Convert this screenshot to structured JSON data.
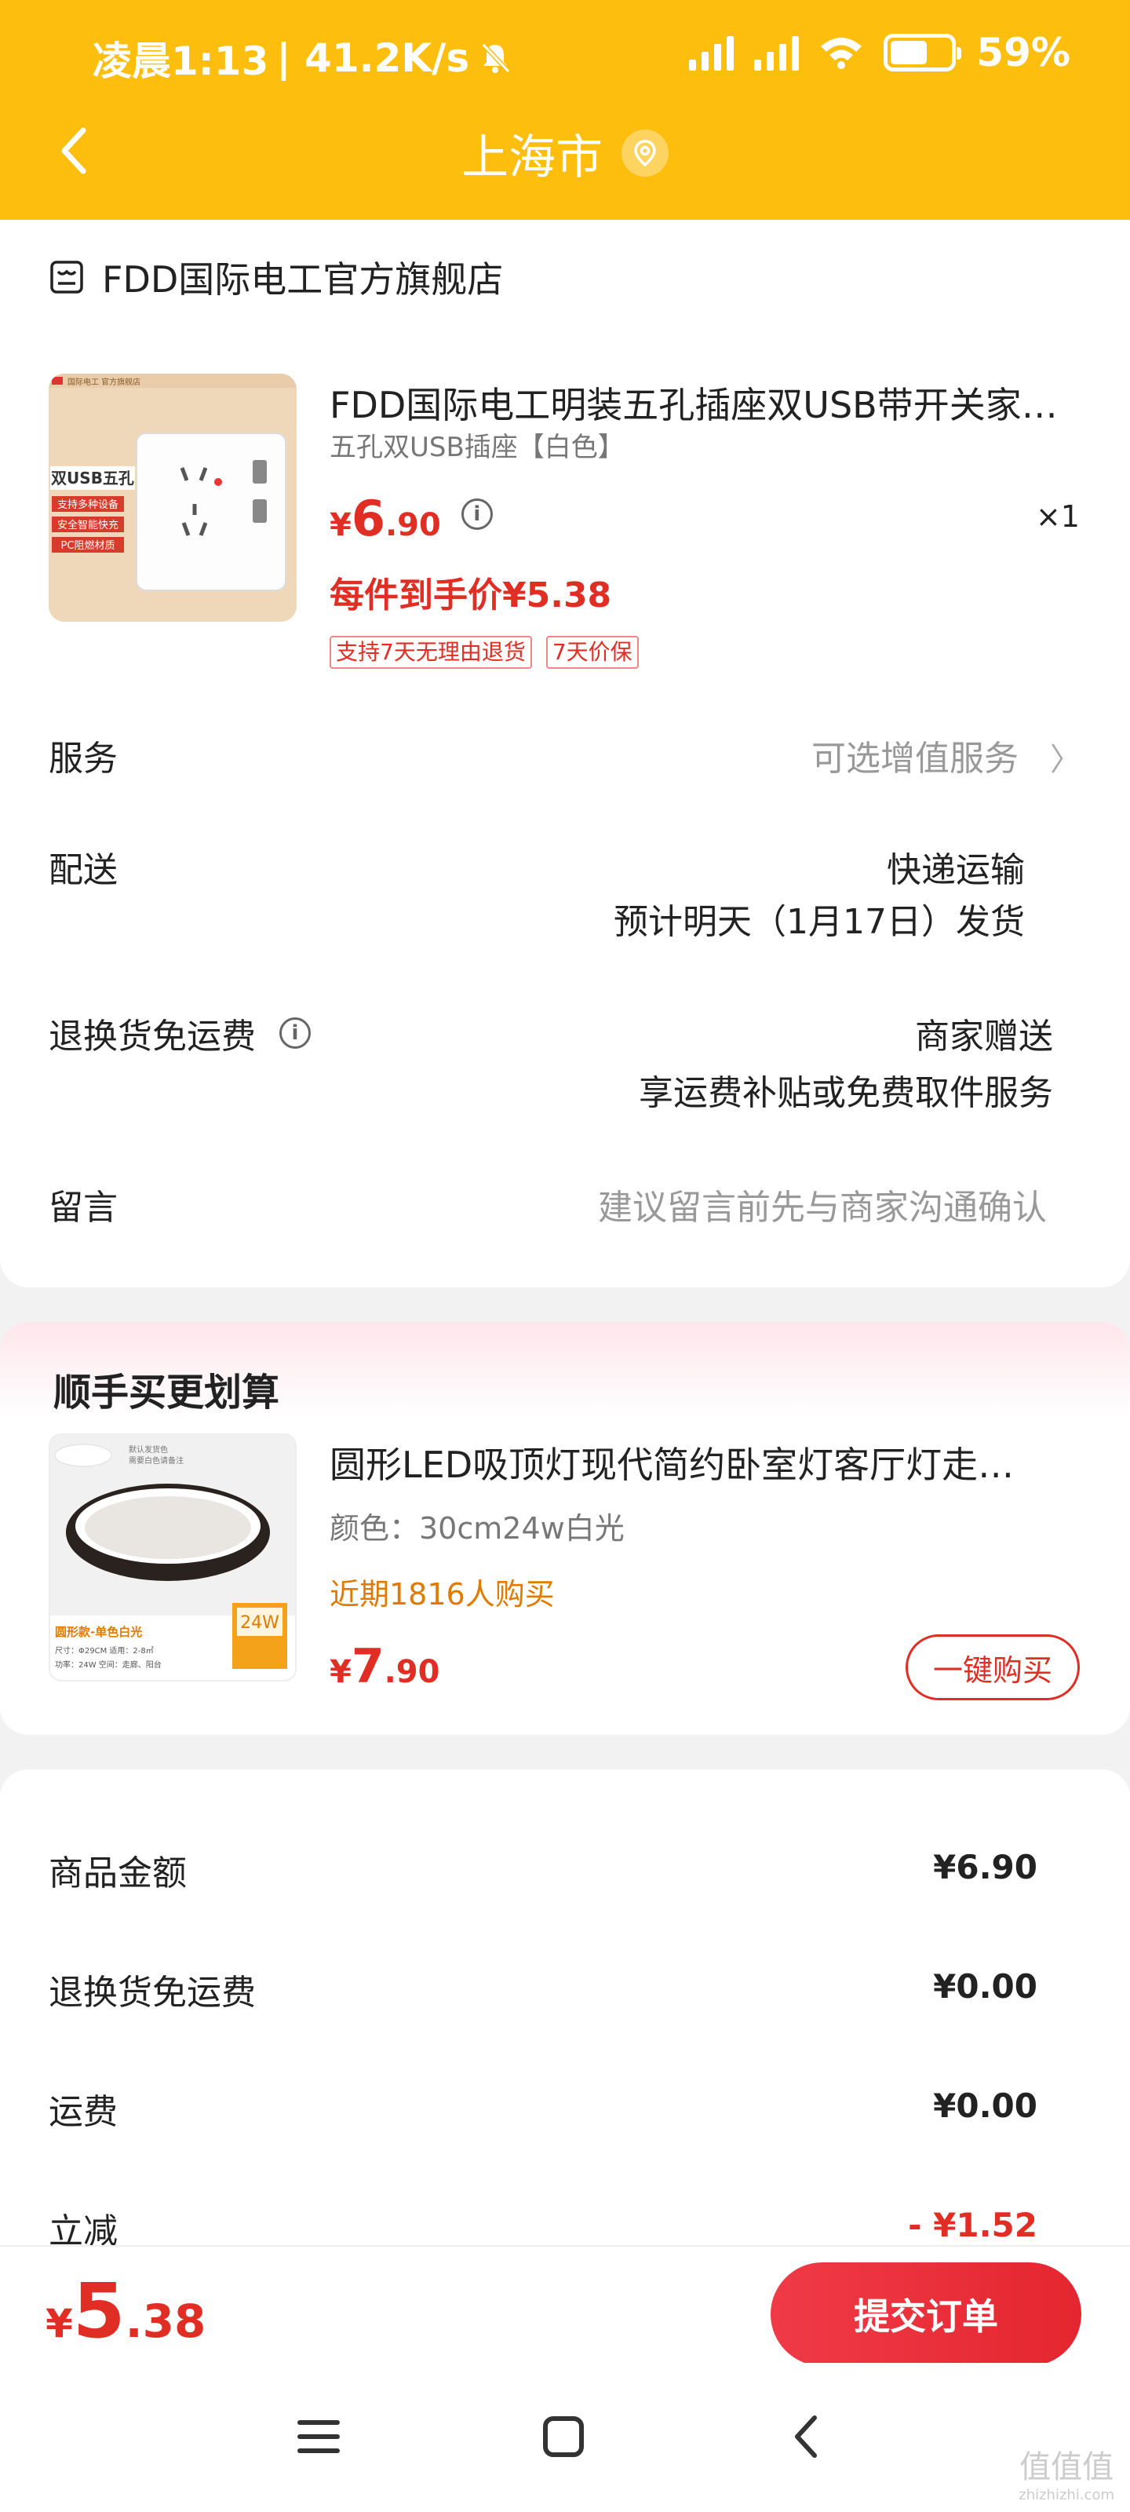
{
  "status_bar": {
    "time": "凌晨1:13",
    "net_speed": "| 41.2K/s",
    "battery": "59%"
  },
  "nav": {
    "title": "上海市"
  },
  "order": {
    "shop_name": "FDD国际电工官方旗舰店",
    "product": {
      "title": "FDD国际电工明装五孔插座双USB带开关家…",
      "spec": "五孔双USB插座【白色】",
      "price_yen": "¥",
      "price_int": "6",
      "price_dec": ".90",
      "quantity": "×1",
      "final_price": "每件到手价¥5.38",
      "tags": [
        "支持7天无理由退货",
        "7天价保"
      ],
      "image_text": {
        "brand": "国际电工 官方旗舰店",
        "headline": "双USB五孔",
        "features": [
          "支持多种设备",
          "安全智能快充",
          "PC阻燃材质"
        ]
      }
    },
    "rows": {
      "service_label": "服务",
      "service_value": "可选增值服务",
      "delivery_label": "配送",
      "delivery_method": "快递运输",
      "delivery_eta": "预计明天（1月17日）发货",
      "return_label": "退换货免运费",
      "return_value1": "商家赠送",
      "return_value2": "享运费补贴或免费取件服务",
      "message_label": "留言",
      "message_placeholder": "建议留言前先与商家沟通确认"
    }
  },
  "recommend": {
    "title": "顺手买更划算",
    "name": "圆形LED吸顶灯现代简约卧室灯客厅灯走…",
    "spec": "颜色：30cm24w白光",
    "sales": "近期1816人购买",
    "price_yen": "¥",
    "price_int": "7",
    "price_dec": ".90",
    "buy_label": "一键购买",
    "image_text": {
      "top": "默认发货色",
      "top2": "需要白色请备注",
      "badge": "24W",
      "caption": "圆形款-单色白光",
      "spec1": "尺寸：Φ29CM  适用：2-8㎡",
      "spec2": "功率：24W  空间：走廊、阳台"
    }
  },
  "summary": {
    "rows": [
      {
        "label": "商品金额",
        "value": "¥6.90",
        "red": false
      },
      {
        "label": "退换货免运费",
        "value": "¥0.00",
        "red": false
      },
      {
        "label": "运费",
        "value": "¥0.00",
        "red": false
      },
      {
        "label": "立减",
        "value": "- ¥1.52",
        "red": true
      }
    ]
  },
  "bottom": {
    "total_yen": "¥",
    "total_int": "5",
    "total_dec": ".38",
    "submit_label": "提交订单"
  },
  "watermark": {
    "main": "值值值",
    "sub": "zhizhizhi.com"
  },
  "colors": {
    "header": "#fdbe0d",
    "price_red": "#e02e24",
    "sales_orange": "#e07b00"
  }
}
